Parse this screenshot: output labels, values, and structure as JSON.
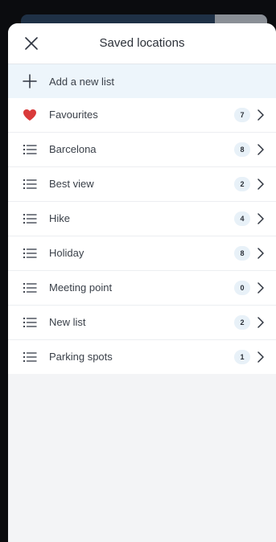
{
  "header": {
    "title": "Saved locations",
    "close_icon": "close-icon"
  },
  "add_list": {
    "label": "Add a new list",
    "icon": "plus-icon"
  },
  "lists": [
    {
      "name": "Favourites",
      "count": "7",
      "icon": "heart-icon"
    },
    {
      "name": "Barcelona",
      "count": "8",
      "icon": "list-icon"
    },
    {
      "name": "Best view",
      "count": "2",
      "icon": "list-icon"
    },
    {
      "name": "Hike",
      "count": "4",
      "icon": "list-icon"
    },
    {
      "name": "Holiday",
      "count": "8",
      "icon": "list-icon"
    },
    {
      "name": "Meeting point",
      "count": "0",
      "icon": "list-icon"
    },
    {
      "name": "New list",
      "count": "2",
      "icon": "list-icon"
    },
    {
      "name": "Parking spots",
      "count": "1",
      "icon": "list-icon"
    }
  ],
  "colors": {
    "accent_heart": "#d93a3a",
    "icon_dark": "#2f3540",
    "badge_bg": "#e8f1f8",
    "add_row_bg": "#edf5fb"
  }
}
